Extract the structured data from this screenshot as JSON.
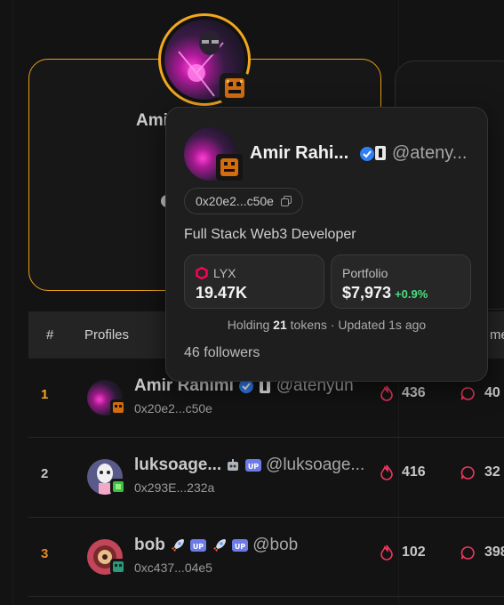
{
  "featured": {
    "name_partial": "Ami"
  },
  "table": {
    "headers": {
      "rank": "#",
      "profiles": "Profiles",
      "comments_partial": "me"
    },
    "rows": [
      {
        "rank": "1",
        "rank_color": "#f5a623",
        "name": "Amir Rahimi",
        "handle": "@atenyun",
        "address": "0x20e2...c50e",
        "fires": "436",
        "comments": "40"
      },
      {
        "rank": "2",
        "rank_color": "#c8c8c8",
        "name": "luksoage...",
        "handle": "@luksoage...",
        "address": "0x293E...232a",
        "fires": "416",
        "comments": "32"
      },
      {
        "rank": "3",
        "rank_color": "#e08a2a",
        "name": "bob",
        "handle": "@bob",
        "address": "0xc437...04e5",
        "fires": "102",
        "comments": "398"
      }
    ]
  },
  "popover": {
    "name": "Amir Rahi...",
    "handle": "@ateny...",
    "address": "0x20e2...c50e",
    "bio": "Full Stack Web3 Developer",
    "lyx_label": "LYX",
    "lyx_value": "19.47K",
    "portfolio_label": "Portfolio",
    "portfolio_value": "$7,973",
    "portfolio_change": "+0.9%",
    "holding_prefix": "Holding ",
    "holding_count": "21",
    "holding_suffix": " tokens · Updated 1s ago",
    "followers": "46 followers"
  },
  "colors": {
    "accent": "#f5a623",
    "lyx": "#fe005b",
    "positive": "#4ade80",
    "verified": "#2f7ff5",
    "fire": "#f0365f"
  }
}
